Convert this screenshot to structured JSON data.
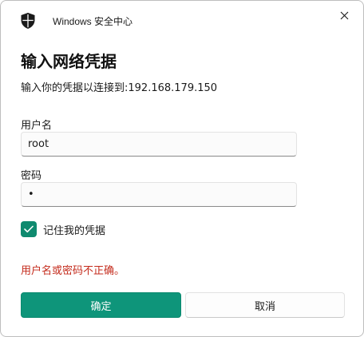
{
  "window": {
    "title": "Windows 安全中心",
    "close_icon": "close-icon",
    "app_icon": "shield-icon"
  },
  "dialog": {
    "heading": "输入网络凭据",
    "subtitle": "输入你的凭据以连接到:192.168.179.150",
    "username": {
      "label": "用户名",
      "value": "root"
    },
    "password": {
      "label": "密码",
      "value": "•"
    },
    "remember": {
      "label": "记住我的凭据",
      "checked": true
    },
    "error": "用户名或密码不正确。",
    "buttons": {
      "ok": "确定",
      "cancel": "取消"
    }
  },
  "colors": {
    "accent": "#0e957a",
    "error": "#c42b1c"
  }
}
